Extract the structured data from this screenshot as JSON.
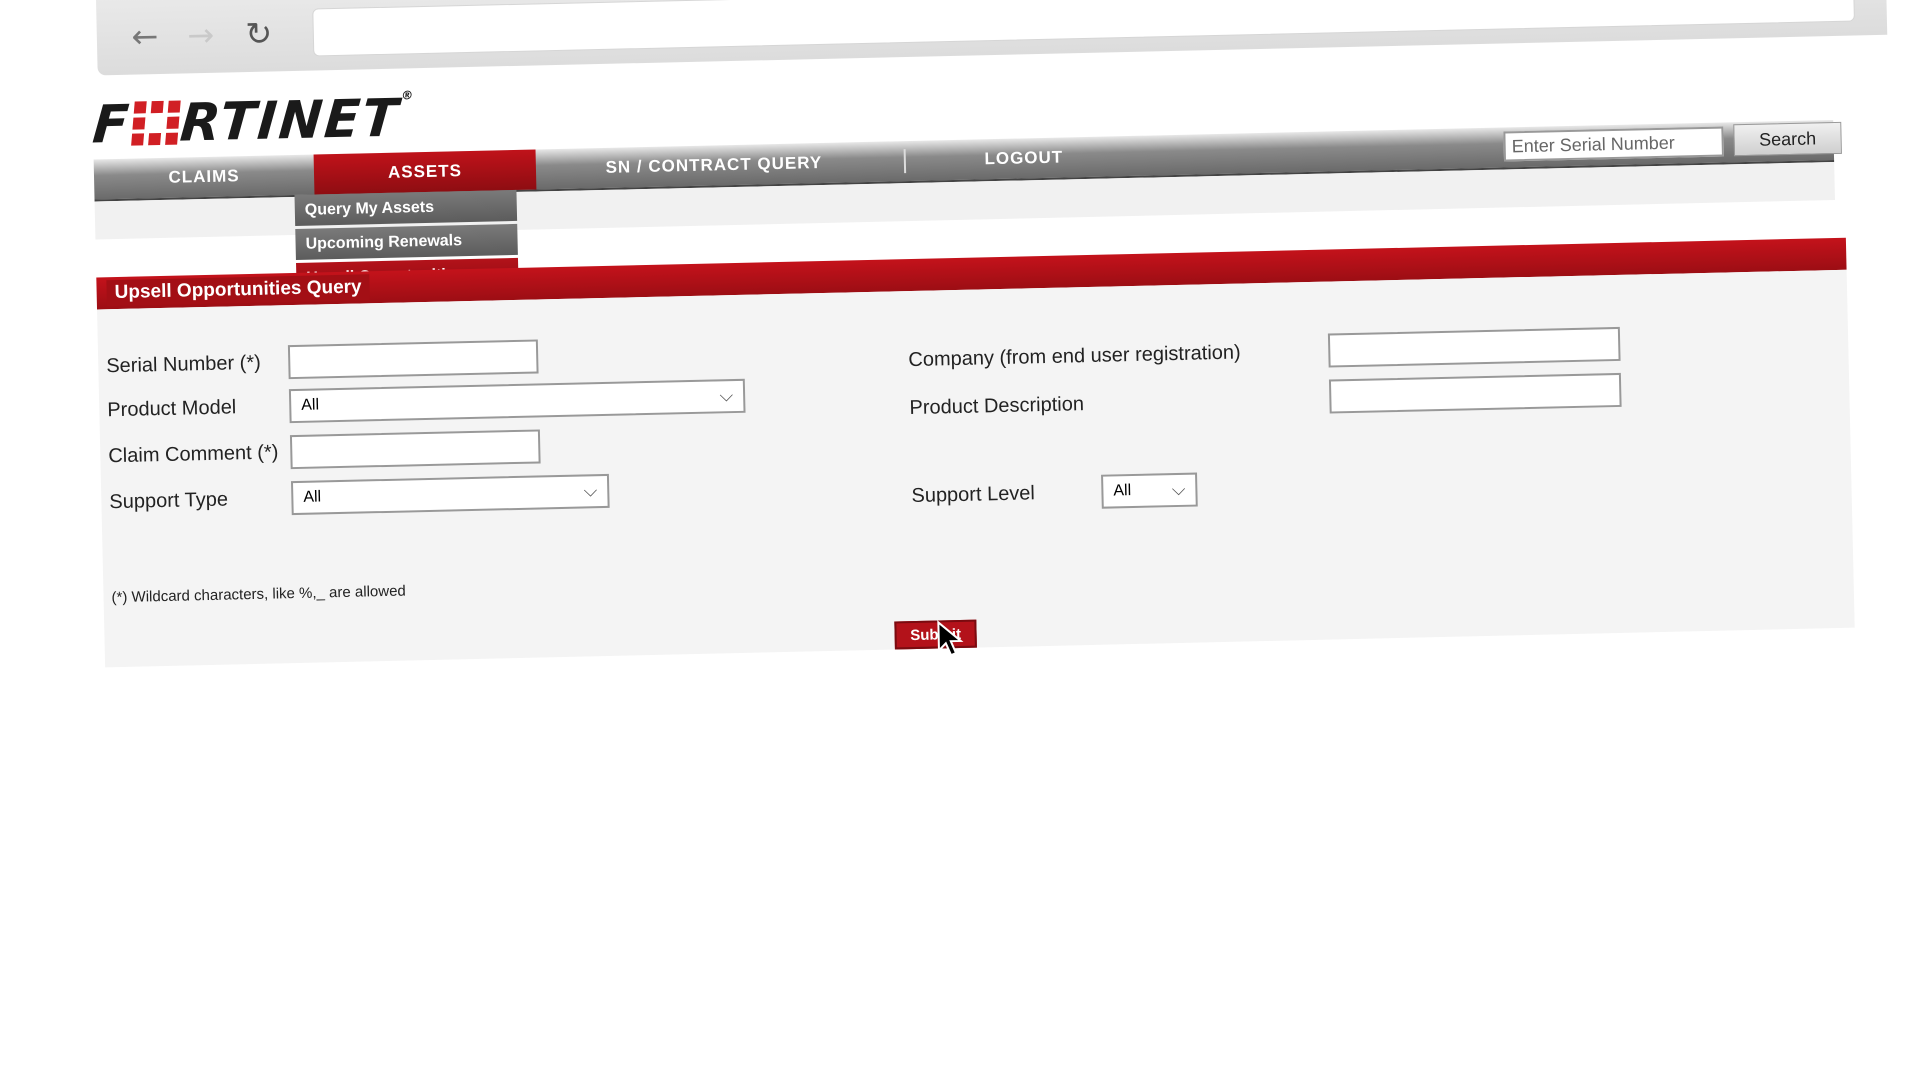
{
  "browser": {
    "back_icon": "←",
    "forward_icon": "→",
    "reload_icon": "↻"
  },
  "logo": {
    "text_f": "F",
    "text_rest": "RTINET",
    "reg": "®"
  },
  "nav": {
    "claims": "CLAIMS",
    "assets": "ASSETS",
    "sn_contract_query": "SN / CONTRACT QUERY",
    "logout": "LOGOUT"
  },
  "search": {
    "placeholder": "Enter Serial Number",
    "button": "Search"
  },
  "submenu": {
    "items": [
      {
        "label": "Query My Assets"
      },
      {
        "label": "Upcoming Renewals"
      },
      {
        "label": "Upsell Opportunities"
      }
    ]
  },
  "panel": {
    "title": "Upsell Opportunities Query"
  },
  "form": {
    "serial_number_label": "Serial Number (*)",
    "product_model_label": "Product Model",
    "product_model_value": "All",
    "claim_comment_label": "Claim Comment (*)",
    "support_type_label": "Support Type",
    "support_type_value": "All",
    "company_label": "Company (from end user registration)",
    "product_description_label": "Product Description",
    "support_level_label": "Support Level",
    "support_level_value": "All",
    "note": "(*) Wildcard characters, like %,_ are allowed",
    "submit": "Submit"
  },
  "colors": {
    "brand_red": "#b3121a",
    "nav_gray": "#6a6a6a"
  }
}
